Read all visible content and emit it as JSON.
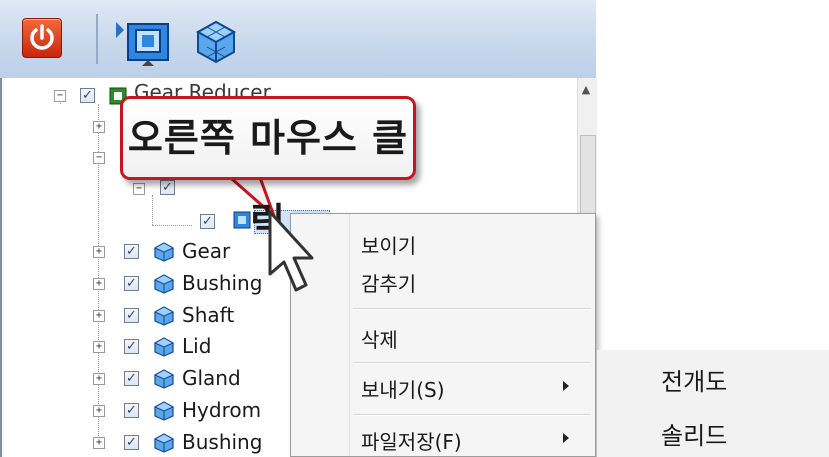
{
  "toolbar": {
    "power_icon": "power-icon",
    "view_icon": "part-view-icon",
    "cube_icon": "3d-cube-icon",
    "accent": "#d9381e"
  },
  "tree": {
    "root": {
      "label": "Gear Reducer",
      "expanded": true,
      "checked": true
    },
    "callout_text": "오른쪽 마우스 클릭",
    "items": [
      {
        "label": "Gear",
        "checked": true
      },
      {
        "label": "Bushing",
        "checked": true
      },
      {
        "label": "Shaft",
        "checked": true
      },
      {
        "label": "Lid",
        "checked": true
      },
      {
        "label": "Gland",
        "checked": true
      },
      {
        "label": "Hydrom",
        "checked": true
      },
      {
        "label": "Bushing",
        "checked": true
      }
    ]
  },
  "context_menu": {
    "items": [
      {
        "label": "보이기",
        "has_submenu": false
      },
      {
        "label": "감추기",
        "has_submenu": false
      },
      {
        "label": "삭제",
        "has_submenu": false
      },
      {
        "label": "보내기(S)",
        "has_submenu": true
      },
      {
        "label": "파일저장(F)",
        "has_submenu": true
      }
    ]
  },
  "submenu": {
    "items": [
      {
        "label": "전개도"
      },
      {
        "label": "솔리드"
      }
    ]
  }
}
